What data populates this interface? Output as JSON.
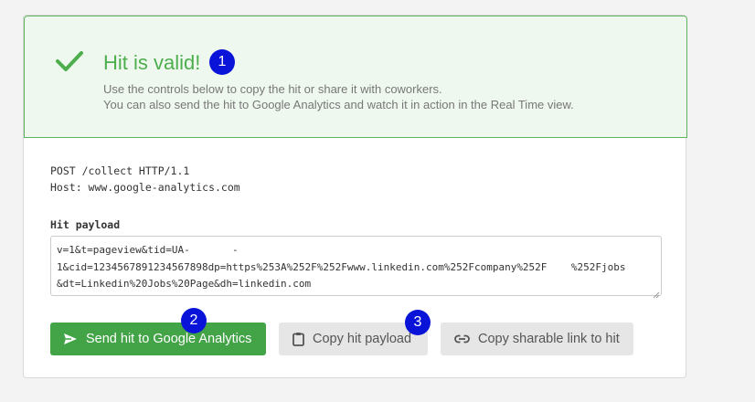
{
  "banner": {
    "title": "Hit is valid!",
    "description_line1": "Use the controls below to copy the hit or share it with coworkers.",
    "description_line2": "You can also send the hit to Google Analytics and watch it in action in the Real Time view.",
    "accent_color": "#4cae4c"
  },
  "badges": {
    "one": "1",
    "two": "2",
    "three": "3",
    "color": "#0a14d8"
  },
  "request": {
    "line1": "POST /collect HTTP/1.1",
    "line2": "Host: www.google-analytics.com"
  },
  "payload": {
    "label": "Hit payload",
    "value": "v=1&t=pageview&tid=UA-       -\n1&cid=1234567891234567898dp=https%253A%252F%252Fwww.linkedin.com%252Fcompany%252F    %252Fjobs\n&dt=Linkedin%20Jobs%20Page&dh=linkedin.com"
  },
  "buttons": {
    "send": "Send hit to Google Analytics",
    "copy": "Copy hit payload",
    "share": "Copy sharable link to hit"
  },
  "icons": {
    "check": "check-icon",
    "send": "send-icon",
    "clipboard": "clipboard-icon",
    "link": "link-icon"
  }
}
